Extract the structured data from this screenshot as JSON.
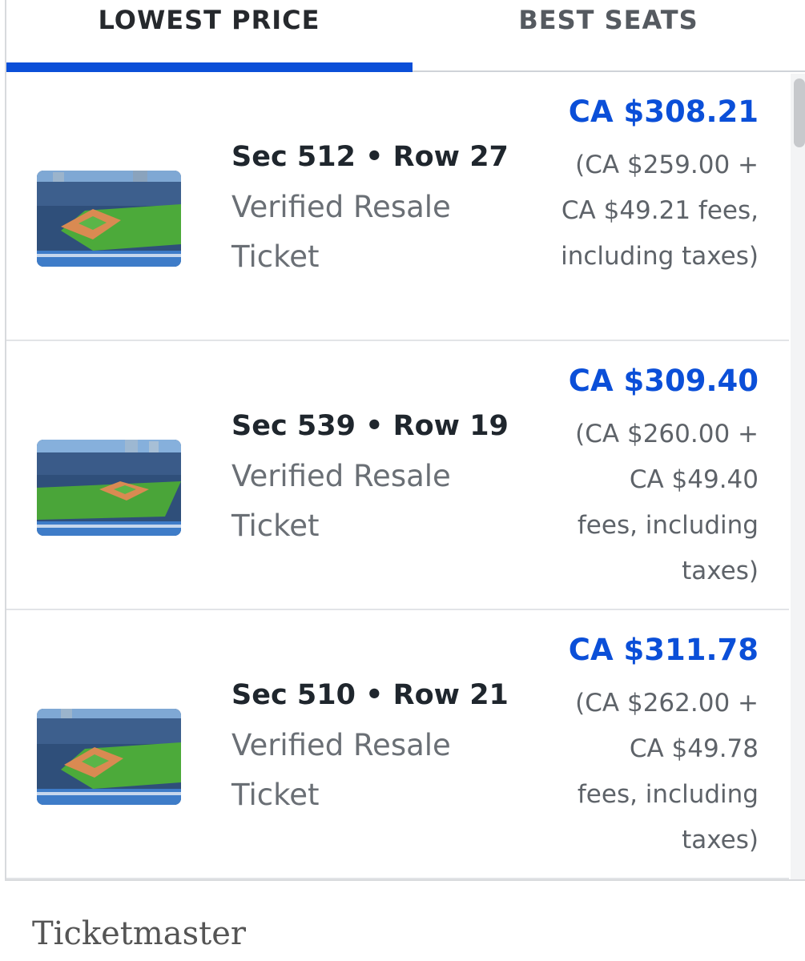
{
  "tabs": [
    {
      "label": "LOWEST PRICE",
      "active": true
    },
    {
      "label": "BEST SEATS",
      "active": false
    }
  ],
  "accent_color": "#0b4fd8",
  "listings": [
    {
      "seat": "Sec 512 • Row 27",
      "ticket_type": "Verified Resale Ticket",
      "price": "CA $308.21",
      "breakdown": "(CA $259.00 + CA $49.21 fees, including taxes)",
      "thumbnail_icon": "stadium-thumbnail"
    },
    {
      "seat": "Sec 539 • Row 19",
      "ticket_type": "Verified Resale Ticket",
      "price": "CA $309.40",
      "breakdown": "(CA $260.00 + CA $49.40 fees, including taxes)",
      "thumbnail_icon": "stadium-thumbnail"
    },
    {
      "seat": "Sec 510 • Row 21",
      "ticket_type": "Verified Resale Ticket",
      "price": "CA $311.78",
      "breakdown": "(CA $262.00 + CA $49.78 fees, including taxes)",
      "thumbnail_icon": "stadium-thumbnail"
    }
  ],
  "caption": "Ticketmaster"
}
